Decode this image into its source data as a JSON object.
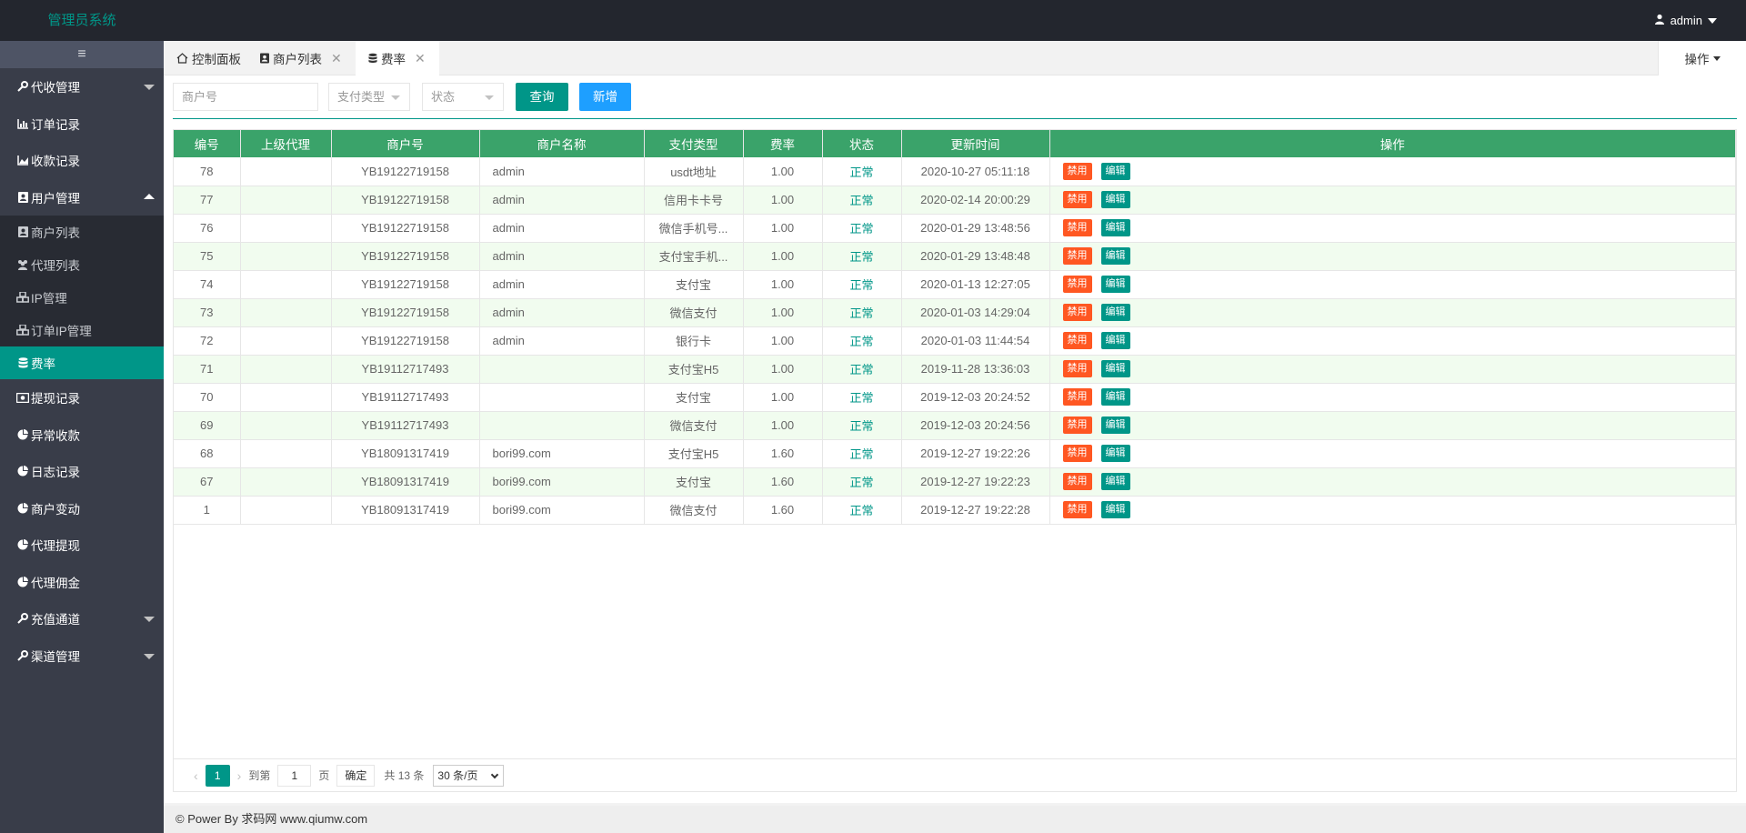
{
  "header": {
    "title": "管理员系统",
    "user": "admin"
  },
  "sidebar": {
    "toggle": "≡",
    "items": [
      {
        "label": "代收管理",
        "icon": "wrench-icon"
      },
      {
        "label": "订单记录",
        "icon": "bar-chart-icon"
      },
      {
        "label": "收款记录",
        "icon": "area-chart-icon"
      },
      {
        "label": "用户管理",
        "icon": "contact-icon"
      },
      {
        "label": "商户列表",
        "icon": "contact-icon"
      },
      {
        "label": "代理列表",
        "icon": "users-icon"
      },
      {
        "label": "IP管理",
        "icon": "cubes-icon"
      },
      {
        "label": "订单IP管理",
        "icon": "cubes-icon"
      },
      {
        "label": "费率",
        "icon": "database-icon"
      },
      {
        "label": "提现记录",
        "icon": "money-icon"
      },
      {
        "label": "异常收款",
        "icon": "pie-chart-icon"
      },
      {
        "label": "日志记录",
        "icon": "pie-chart-icon"
      },
      {
        "label": "商户变动",
        "icon": "pie-chart-icon"
      },
      {
        "label": "代理提现",
        "icon": "pie-chart-icon"
      },
      {
        "label": "代理佣金",
        "icon": "pie-chart-icon"
      },
      {
        "label": "充值通道",
        "icon": "wrench-icon"
      },
      {
        "label": "渠道管理",
        "icon": "wrench-icon"
      }
    ]
  },
  "tabs": [
    {
      "label": "控制面板",
      "icon": "home-icon"
    },
    {
      "label": "商户列表",
      "icon": "contact-icon"
    },
    {
      "label": "费率",
      "icon": "database-icon"
    }
  ],
  "tab_ops": "操作",
  "search": {
    "merchant_placeholder": "商户号",
    "paytype_placeholder": "支付类型",
    "status_placeholder": "状态",
    "query_label": "查询",
    "add_label": "新增"
  },
  "table": {
    "columns": [
      "编号",
      "上级代理",
      "商户号",
      "商户名称",
      "支付类型",
      "费率",
      "状态",
      "更新时间",
      "操作"
    ],
    "ban_label": "禁用",
    "edit_label": "编辑",
    "rows": [
      {
        "id": "78",
        "agent": "",
        "merchant_no": "YB19122719158",
        "merchant_name": "admin",
        "pay_type": "usdt地址",
        "rate": "1.00",
        "status": "正常",
        "updated": "2020-10-27 05:11:18"
      },
      {
        "id": "77",
        "agent": "",
        "merchant_no": "YB19122719158",
        "merchant_name": "admin",
        "pay_type": "信用卡卡号",
        "rate": "1.00",
        "status": "正常",
        "updated": "2020-02-14 20:00:29"
      },
      {
        "id": "76",
        "agent": "",
        "merchant_no": "YB19122719158",
        "merchant_name": "admin",
        "pay_type": "微信手机号...",
        "rate": "1.00",
        "status": "正常",
        "updated": "2020-01-29 13:48:56"
      },
      {
        "id": "75",
        "agent": "",
        "merchant_no": "YB19122719158",
        "merchant_name": "admin",
        "pay_type": "支付宝手机...",
        "rate": "1.00",
        "status": "正常",
        "updated": "2020-01-29 13:48:48"
      },
      {
        "id": "74",
        "agent": "",
        "merchant_no": "YB19122719158",
        "merchant_name": "admin",
        "pay_type": "支付宝",
        "rate": "1.00",
        "status": "正常",
        "updated": "2020-01-13 12:27:05"
      },
      {
        "id": "73",
        "agent": "",
        "merchant_no": "YB19122719158",
        "merchant_name": "admin",
        "pay_type": "微信支付",
        "rate": "1.00",
        "status": "正常",
        "updated": "2020-01-03 14:29:04"
      },
      {
        "id": "72",
        "agent": "",
        "merchant_no": "YB19122719158",
        "merchant_name": "admin",
        "pay_type": "银行卡",
        "rate": "1.00",
        "status": "正常",
        "updated": "2020-01-03 11:44:54"
      },
      {
        "id": "71",
        "agent": "",
        "merchant_no": "YB19112717493",
        "merchant_name": "",
        "pay_type": "支付宝H5",
        "rate": "1.00",
        "status": "正常",
        "updated": "2019-11-28 13:36:03"
      },
      {
        "id": "70",
        "agent": "",
        "merchant_no": "YB19112717493",
        "merchant_name": "",
        "pay_type": "支付宝",
        "rate": "1.00",
        "status": "正常",
        "updated": "2019-12-03 20:24:52"
      },
      {
        "id": "69",
        "agent": "",
        "merchant_no": "YB19112717493",
        "merchant_name": "",
        "pay_type": "微信支付",
        "rate": "1.00",
        "status": "正常",
        "updated": "2019-12-03 20:24:56"
      },
      {
        "id": "68",
        "agent": "",
        "merchant_no": "YB18091317419",
        "merchant_name": "bori99.com",
        "pay_type": "支付宝H5",
        "rate": "1.60",
        "status": "正常",
        "updated": "2019-12-27 19:22:26"
      },
      {
        "id": "67",
        "agent": "",
        "merchant_no": "YB18091317419",
        "merchant_name": "bori99.com",
        "pay_type": "支付宝",
        "rate": "1.60",
        "status": "正常",
        "updated": "2019-12-27 19:22:23"
      },
      {
        "id": "1",
        "agent": "",
        "merchant_no": "YB18091317419",
        "merchant_name": "bori99.com",
        "pay_type": "微信支付",
        "rate": "1.60",
        "status": "正常",
        "updated": "2019-12-27 19:22:28"
      }
    ]
  },
  "pager": {
    "prev": "‹",
    "next": "›",
    "current": "1",
    "goto_label": "到第",
    "goto_value": "1",
    "page_unit": "页",
    "confirm_label": "确定",
    "total_label": "共 13 条",
    "per_page": "30 条/页"
  },
  "footer": "© Power By 求码网 www.qiumw.com",
  "colors": {
    "header_bg": "#23262e",
    "sidebar_bg": "#393d49",
    "accent": "#009688",
    "table_head": "#3aa36a",
    "ban": "#ff5722",
    "add": "#1e9fff"
  }
}
